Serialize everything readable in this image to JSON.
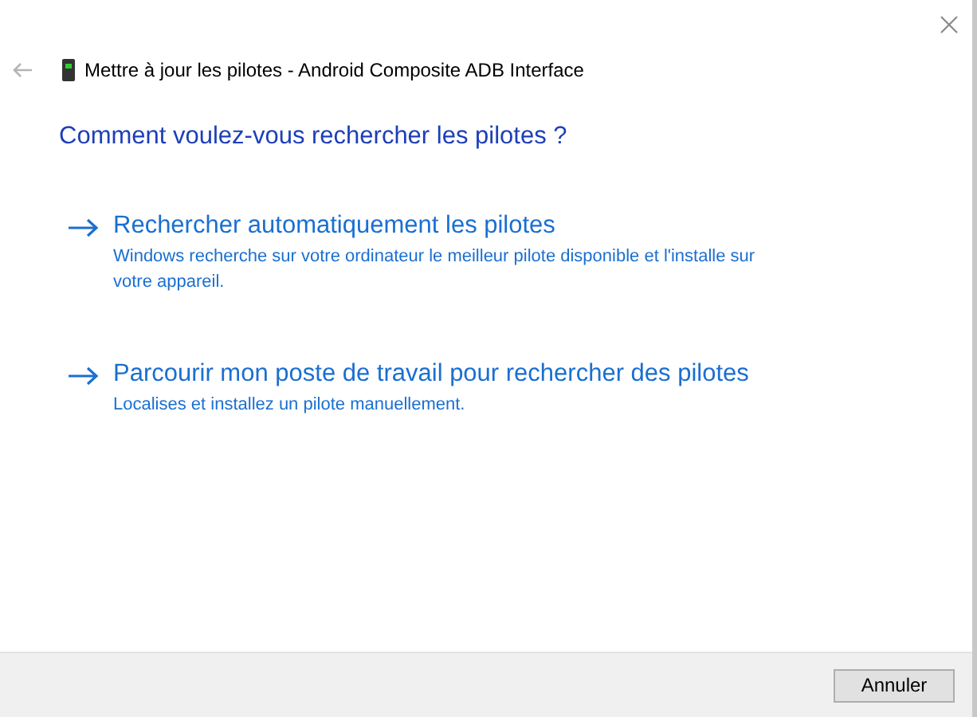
{
  "window": {
    "title": "Mettre à jour les pilotes - Android Composite ADB Interface"
  },
  "heading": "Comment voulez-vous rechercher les pilotes ?",
  "options": [
    {
      "title": "Rechercher automatiquement les pilotes",
      "description": "Windows recherche sur votre ordinateur le meilleur pilote disponible et l'installe sur votre appareil."
    },
    {
      "title": "Parcourir mon poste de travail pour rechercher des pilotes",
      "description": "Localises et installez un pilote manuellement."
    }
  ],
  "buttons": [
    "Annuler"
  ]
}
